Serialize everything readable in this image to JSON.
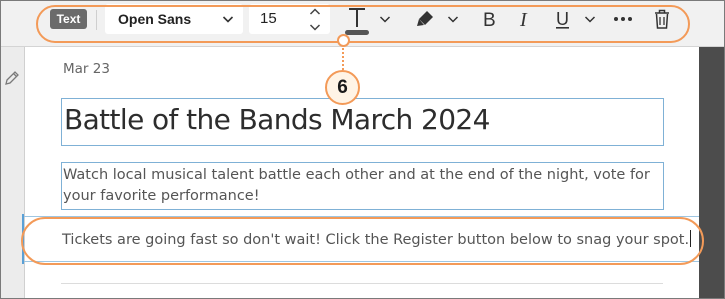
{
  "toolbar": {
    "text_label": "Text",
    "font_family": "Open Sans",
    "font_size": "15",
    "bold_label": "B",
    "italic_label": "I",
    "underline_label": "U",
    "icons": {
      "text_color": "text-color-icon",
      "highlight": "highlighter-icon",
      "more": "more-options-icon",
      "delete": "trash-icon",
      "dropdown": "chevron-down-icon",
      "stepper_up": "chevron-up-icon",
      "stepper_down": "chevron-down-icon"
    }
  },
  "sidebar": {
    "edit_icon": "pencil-icon"
  },
  "callout": {
    "number": "6",
    "accent_color": "#f39a58"
  },
  "document": {
    "date": "Mar 23",
    "title": "Battle of the Bands March 2024",
    "description": "Watch local musical talent battle each other and at the end of the night, vote for your favorite performance!",
    "body": "Tickets are going fast so don't wait! Click the Register button below to snag your spot."
  },
  "colors": {
    "selection_border": "#7fb1d6",
    "callout_ring": "#f39a58",
    "text_chip_bg": "#6b6b6b"
  }
}
